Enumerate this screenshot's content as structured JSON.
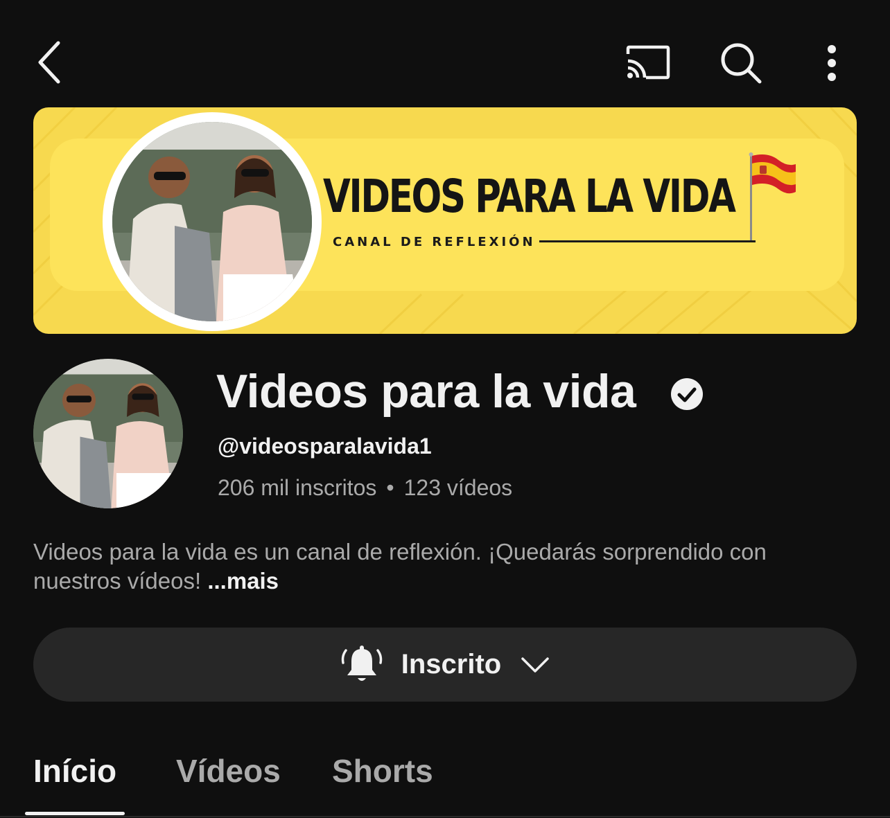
{
  "topbar": {
    "back_icon": "chevron-left-icon",
    "cast_icon": "cast-icon",
    "search_icon": "search-icon",
    "more_icon": "more-vertical-icon"
  },
  "banner": {
    "title": "VIDEOS PARA LA VIDA",
    "subtitle": "CANAL DE REFLEXIÓN",
    "flag": "spain-flag-icon",
    "background_color": "#f7d94f"
  },
  "channel": {
    "name": "Videos para la vida",
    "verified_icon": "verified-check-icon",
    "handle": "@videosparalavida1",
    "subscribers": "206 mil inscritos",
    "separator": "•",
    "videos": "123 vídeos",
    "description": "Videos para la vida es un canal de reflexión. ¡Quedarás sorprendido con nuestros vídeos!",
    "more_label": "...mais"
  },
  "subscribe": {
    "label": "Inscrito",
    "bell_icon": "bell-ringing-icon",
    "chevron_icon": "chevron-down-icon"
  },
  "tabs": [
    {
      "label": "Início",
      "active": true
    },
    {
      "label": "Vídeos",
      "active": false
    },
    {
      "label": "Shorts",
      "active": false
    }
  ],
  "colors": {
    "background": "#0f0f0f",
    "button": "#272727",
    "secondary_text": "#aaaaaa",
    "primary_text": "#f1f1f1"
  }
}
